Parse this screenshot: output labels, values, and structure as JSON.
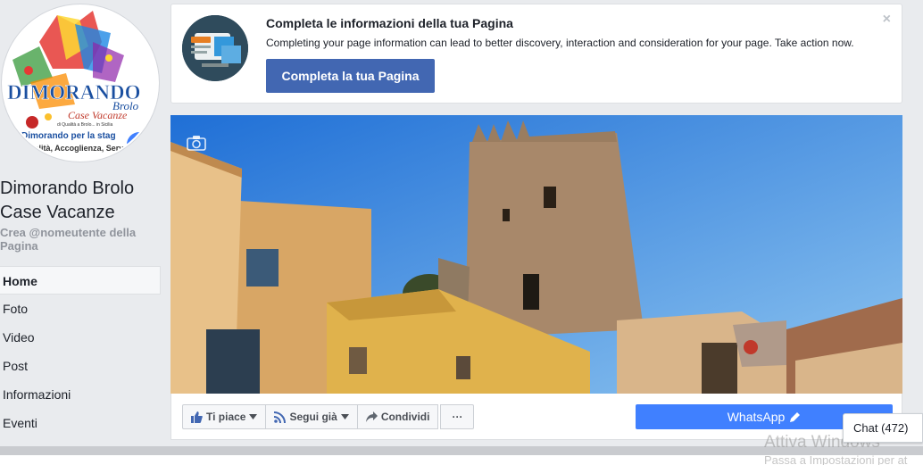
{
  "page": {
    "name": "Dimorando Brolo Case Vacanze",
    "username_prompt": "Crea @nomeutente della Pagina"
  },
  "logo": {
    "line1": "DIMORANDO",
    "line2": "Brolo",
    "line3": "Case Vacanze",
    "line4": "di Qualità a Brolo... in Sicilia",
    "line5": "Dimorando per la stag",
    "line6": "Qualità, Accoglienza, Serv"
  },
  "nav": {
    "items": [
      {
        "label": "Home",
        "active": true
      },
      {
        "label": "Foto"
      },
      {
        "label": "Video"
      },
      {
        "label": "Post"
      },
      {
        "label": "Informazioni"
      },
      {
        "label": "Eventi"
      }
    ]
  },
  "prompt": {
    "title": "Completa le informazioni della tua Pagina",
    "text": "Completing your page information can lead to better discovery, interaction and consideration for your page. Take action now.",
    "button": "Completa la tua Pagina",
    "close": "×"
  },
  "actions": {
    "like": "Ti piace",
    "follow": "Segui già",
    "share": "Condividi",
    "more": "···",
    "whatsapp": "WhatsApp"
  },
  "chat": {
    "label": "Chat (472)"
  },
  "watermark": {
    "line1": "Attiva Windows",
    "line2": "Passa a Impostazioni per at"
  },
  "colors": {
    "brand_blue": "#4267b2",
    "whatsapp_blue": "#4080ff",
    "background": "#e9ebee"
  }
}
